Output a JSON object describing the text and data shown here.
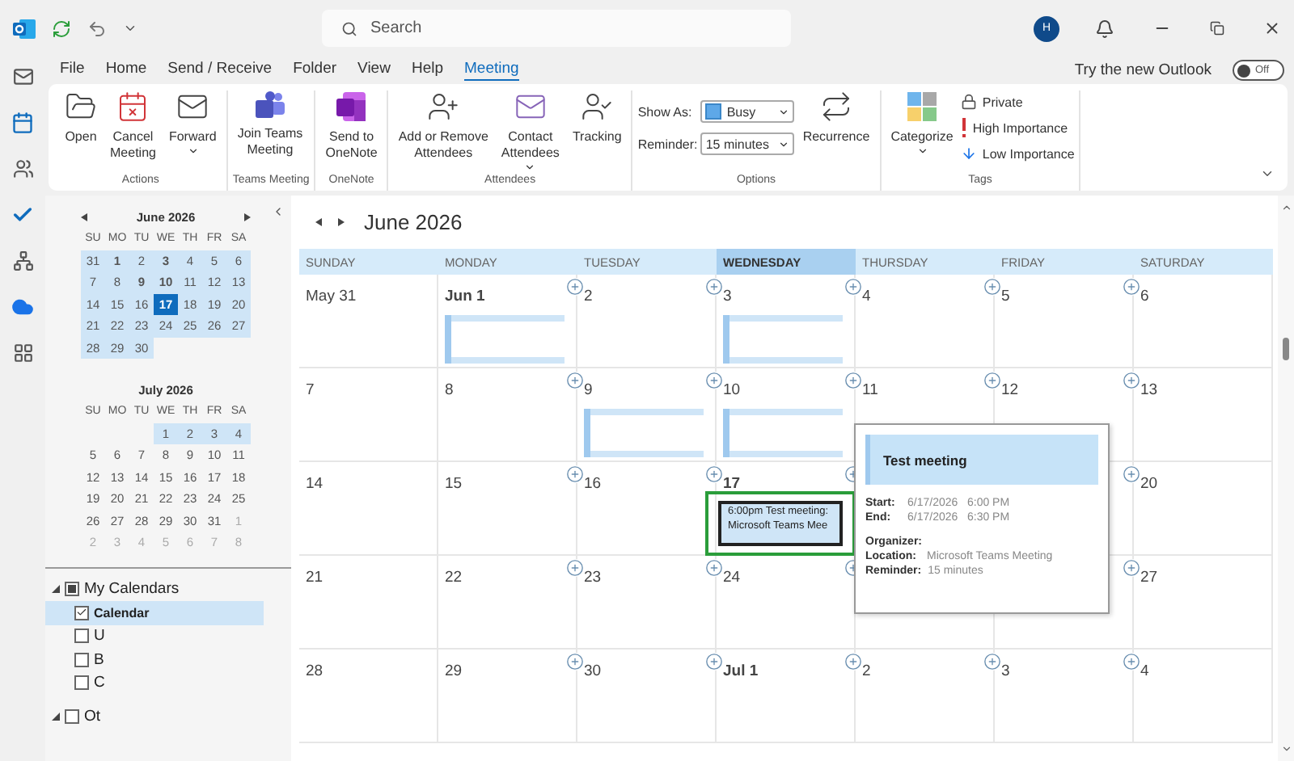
{
  "title_bar": {
    "search": {
      "placeholder": "Search"
    },
    "avatar": "H"
  },
  "menu_tabs": [
    {
      "label": "File",
      "selected": false
    },
    {
      "label": "Home",
      "selected": false
    },
    {
      "label": "Send / Receive",
      "selected": false
    },
    {
      "label": "Folder",
      "selected": false
    },
    {
      "label": "View",
      "selected": false
    },
    {
      "label": "Help",
      "selected": false
    },
    {
      "label": "Meeting",
      "selected": true
    }
  ],
  "new_outlook": {
    "label": "Try the new Outlook",
    "toggle": "Off",
    "on": false
  },
  "ribbon": [
    {
      "kind": "large",
      "label": "Actions",
      "buttons": [
        {
          "lines": [
            "Open"
          ],
          "dropdown": false
        },
        {
          "lines": [
            "Cancel",
            "Meeting"
          ],
          "dropdown": false
        },
        {
          "lines": [
            "Forward"
          ],
          "dropdown": true
        }
      ]
    },
    {
      "kind": "large",
      "label": "Teams Meeting",
      "buttons": [
        {
          "lines": [
            "Join Teams",
            "Meeting"
          ],
          "dropdown": false
        }
      ]
    },
    {
      "kind": "large",
      "label": "OneNote",
      "buttons": [
        {
          "lines": [
            "Send to",
            "OneNote"
          ],
          "dropdown": false
        }
      ]
    },
    {
      "kind": "large",
      "label": "Attendees",
      "buttons": [
        {
          "lines": [
            "Add or Remove",
            "Attendees"
          ],
          "dropdown": false
        },
        {
          "lines": [
            "Contact",
            "Attendees"
          ],
          "dropdown": true
        },
        {
          "lines": [
            "Tracking"
          ],
          "dropdown": false
        }
      ]
    },
    {
      "kind": "options",
      "label": "Options",
      "show_as": {
        "label": "Show As:",
        "value": "Busy"
      },
      "reminder": {
        "label": "Reminder:",
        "value": "15 minutes"
      },
      "buttons": [
        {
          "lines": [
            "Recurrence"
          ],
          "dropdown": false
        }
      ]
    },
    {
      "kind": "tags",
      "label": "Tags",
      "buttons": [
        {
          "lines": [
            "Categorize"
          ],
          "dropdown": true
        }
      ],
      "flags": [
        "Private",
        "High Importance",
        "Low Importance"
      ]
    }
  ],
  "mini_calendars": [
    {
      "title": "June 2026",
      "arrows": true,
      "weekdays": [
        "SU",
        "MO",
        "TU",
        "WE",
        "TH",
        "FR",
        "SA"
      ],
      "weeks": [
        [
          {
            "d": "31",
            "hl": true,
            "selected": false
          },
          {
            "d": "1",
            "hl": true,
            "bold": true,
            "selected": false
          },
          {
            "d": "2",
            "hl": true,
            "selected": false
          },
          {
            "d": "3",
            "hl": true,
            "bold": true,
            "selected": false
          },
          {
            "d": "4",
            "hl": true,
            "selected": false
          },
          {
            "d": "5",
            "hl": true,
            "selected": false
          },
          {
            "d": "6",
            "hl": true,
            "selected": false
          }
        ],
        [
          {
            "d": "7",
            "hl": true,
            "selected": false
          },
          {
            "d": "8",
            "hl": true,
            "selected": false
          },
          {
            "d": "9",
            "hl": true,
            "bold": true,
            "selected": false
          },
          {
            "d": "10",
            "hl": true,
            "bold": true,
            "selected": false
          },
          {
            "d": "11",
            "hl": true,
            "selected": false
          },
          {
            "d": "12",
            "hl": true,
            "selected": false
          },
          {
            "d": "13",
            "hl": true,
            "selected": false
          }
        ],
        [
          {
            "d": "14",
            "hl": true,
            "selected": false
          },
          {
            "d": "15",
            "hl": true,
            "selected": false
          },
          {
            "d": "16",
            "hl": true,
            "selected": false
          },
          {
            "d": "17",
            "hl": true,
            "bold": true,
            "selected": true
          },
          {
            "d": "18",
            "hl": true,
            "selected": false
          },
          {
            "d": "19",
            "hl": true,
            "selected": false
          },
          {
            "d": "20",
            "hl": true,
            "selected": false
          }
        ],
        [
          {
            "d": "21",
            "hl": true,
            "selected": false
          },
          {
            "d": "22",
            "hl": true,
            "selected": false
          },
          {
            "d": "23",
            "hl": true,
            "selected": false
          },
          {
            "d": "24",
            "hl": true,
            "selected": false
          },
          {
            "d": "25",
            "hl": true,
            "selected": false
          },
          {
            "d": "26",
            "hl": true,
            "selected": false
          },
          {
            "d": "27",
            "hl": true,
            "selected": false
          }
        ],
        [
          {
            "d": "28",
            "hl": true,
            "selected": false
          },
          {
            "d": "29",
            "hl": true,
            "selected": false
          },
          {
            "d": "30",
            "hl": true,
            "selected": false
          }
        ]
      ]
    },
    {
      "title": "July 2026",
      "arrows": false,
      "weekdays": [
        "SU",
        "MO",
        "TU",
        "WE",
        "TH",
        "FR",
        "SA"
      ],
      "weeks": [
        [
          {
            "d": "1",
            "hl": true,
            "selected": false
          },
          {
            "d": "2",
            "hl": true,
            "selected": false
          },
          {
            "d": "3",
            "hl": true,
            "selected": false
          },
          {
            "d": "4",
            "hl": true,
            "selected": false
          }
        ],
        [
          {
            "d": "5",
            "selected": false
          },
          {
            "d": "6",
            "selected": false
          },
          {
            "d": "7",
            "selected": false
          },
          {
            "d": "8",
            "selected": false
          },
          {
            "d": "9",
            "selected": false
          },
          {
            "d": "10",
            "selected": false
          },
          {
            "d": "11",
            "selected": false
          }
        ],
        [
          {
            "d": "12",
            "selected": false
          },
          {
            "d": "13",
            "selected": false
          },
          {
            "d": "14",
            "selected": false
          },
          {
            "d": "15",
            "selected": false
          },
          {
            "d": "16",
            "selected": false
          },
          {
            "d": "17",
            "selected": false
          },
          {
            "d": "18",
            "selected": false
          }
        ],
        [
          {
            "d": "19",
            "selected": false
          },
          {
            "d": "20",
            "selected": false
          },
          {
            "d": "21",
            "selected": false
          },
          {
            "d": "22",
            "selected": false
          },
          {
            "d": "23",
            "selected": false
          },
          {
            "d": "24",
            "selected": false
          },
          {
            "d": "25",
            "selected": false
          }
        ],
        [
          {
            "d": "26",
            "selected": false
          },
          {
            "d": "27",
            "selected": false
          },
          {
            "d": "28",
            "selected": false
          },
          {
            "d": "29",
            "selected": false
          },
          {
            "d": "30",
            "selected": false
          },
          {
            "d": "31",
            "selected": false
          },
          {
            "d": "1",
            "dim": true,
            "selected": false
          }
        ],
        [
          {
            "d": "2",
            "dim": true,
            "selected": false
          },
          {
            "d": "3",
            "dim": true,
            "selected": false
          },
          {
            "d": "4",
            "dim": true,
            "selected": false
          },
          {
            "d": "5",
            "dim": true,
            "selected": false
          },
          {
            "d": "6",
            "dim": true,
            "selected": false
          },
          {
            "d": "7",
            "dim": true,
            "selected": false
          },
          {
            "d": "8",
            "dim": true,
            "selected": false
          }
        ]
      ]
    }
  ],
  "folders": [
    {
      "label": "My Calendars",
      "expanded": true,
      "mixed": true,
      "items": [
        {
          "label": "Calendar",
          "checked": true,
          "selected": true
        },
        {
          "label": "U",
          "checked": false,
          "selected": false
        },
        {
          "label": "B",
          "checked": false,
          "selected": false
        },
        {
          "label": "C",
          "checked": false,
          "selected": false
        }
      ]
    },
    {
      "label": "Ot",
      "expanded": true,
      "checked": false
    }
  ],
  "calendar": {
    "title": "June 2026",
    "weekdays": [
      {
        "label": "SUNDAY",
        "selected": false
      },
      {
        "label": "MONDAY",
        "selected": false
      },
      {
        "label": "TUESDAY",
        "selected": false
      },
      {
        "label": "WEDNESDAY",
        "selected": true
      },
      {
        "label": "THURSDAY",
        "selected": false
      },
      {
        "label": "FRIDAY",
        "selected": false
      },
      {
        "label": "SATURDAY",
        "selected": false
      }
    ],
    "weeks": [
      [
        {
          "label": "May 31",
          "bold": false,
          "add_icon": false,
          "busy": false
        },
        {
          "label": "Jun 1",
          "bold": true,
          "add_icon": true,
          "busy": true
        },
        {
          "label": "2",
          "bold": false,
          "add_icon": true,
          "busy": false
        },
        {
          "label": "3",
          "bold": false,
          "add_icon": true,
          "busy": true
        },
        {
          "label": "4",
          "bold": false,
          "add_icon": true,
          "busy": false
        },
        {
          "label": "5",
          "bold": false,
          "add_icon": true,
          "busy": false
        },
        {
          "label": "6",
          "bold": false,
          "add_icon": false,
          "busy": false
        }
      ],
      [
        {
          "label": "7",
          "bold": false,
          "add_icon": false,
          "busy": false
        },
        {
          "label": "8",
          "bold": false,
          "add_icon": true,
          "busy": false
        },
        {
          "label": "9",
          "bold": false,
          "add_icon": true,
          "busy": true
        },
        {
          "label": "10",
          "bold": false,
          "add_icon": true,
          "busy": true
        },
        {
          "label": "11",
          "bold": false,
          "add_icon": true,
          "busy": false
        },
        {
          "label": "12",
          "bold": false,
          "add_icon": true,
          "busy": false
        },
        {
          "label": "13",
          "bold": false,
          "add_icon": false,
          "busy": false
        }
      ],
      [
        {
          "label": "14",
          "bold": false,
          "add_icon": false,
          "busy": false
        },
        {
          "label": "15",
          "bold": false,
          "add_icon": true,
          "busy": false
        },
        {
          "label": "16",
          "bold": false,
          "add_icon": true,
          "busy": false
        },
        {
          "label": "17",
          "bold": true,
          "add_icon": true,
          "busy": false,
          "event": {
            "text": "6:00pm Test meeting: Microsoft Teams Mee",
            "selected": true
          }
        },
        {
          "popup_anchor": true
        },
        {
          "add_icon": true,
          "busy": false
        },
        {
          "label": "20",
          "bold": false,
          "add_icon": false,
          "busy": false
        }
      ],
      [
        {
          "label": "21",
          "bold": false,
          "add_icon": false,
          "busy": false
        },
        {
          "label": "22",
          "bold": false,
          "add_icon": true,
          "busy": false
        },
        {
          "label": "23",
          "bold": false,
          "add_icon": true,
          "busy": false
        },
        {
          "label": "24",
          "bold": false,
          "add_icon": true,
          "busy": false
        },
        {
          "popup_anchor": false
        },
        {
          "add_icon": true,
          "busy": false
        },
        {
          "label": "27",
          "bold": false,
          "add_icon": false,
          "busy": false
        }
      ],
      [
        {
          "label": "28",
          "bold": false,
          "add_icon": false,
          "busy": false
        },
        {
          "label": "29",
          "bold": false,
          "add_icon": true,
          "busy": false
        },
        {
          "label": "30",
          "bold": false,
          "add_icon": true,
          "busy": false
        },
        {
          "label": "Jul 1",
          "bold": true,
          "add_icon": true,
          "busy": false
        },
        {
          "label": "2",
          "bold": false,
          "add_icon": true,
          "busy": false
        },
        {
          "label": "3",
          "bold": false,
          "add_icon": true,
          "busy": false
        },
        {
          "label": "4",
          "bold": false,
          "add_icon": false,
          "busy": false
        }
      ]
    ]
  },
  "popup": {
    "title": "Test meeting",
    "times": [
      {
        "label": "Start:",
        "value": "6/17/2026   6:00 PM"
      },
      {
        "label": "End:",
        "value": "6/17/2026   6:30 PM"
      }
    ],
    "details": [
      {
        "label": "Organizer:"
      },
      {
        "label": "Location:",
        "value": "Microsoft Teams Meeting"
      },
      {
        "label": "Reminder:",
        "value": "15 minutes"
      }
    ]
  }
}
